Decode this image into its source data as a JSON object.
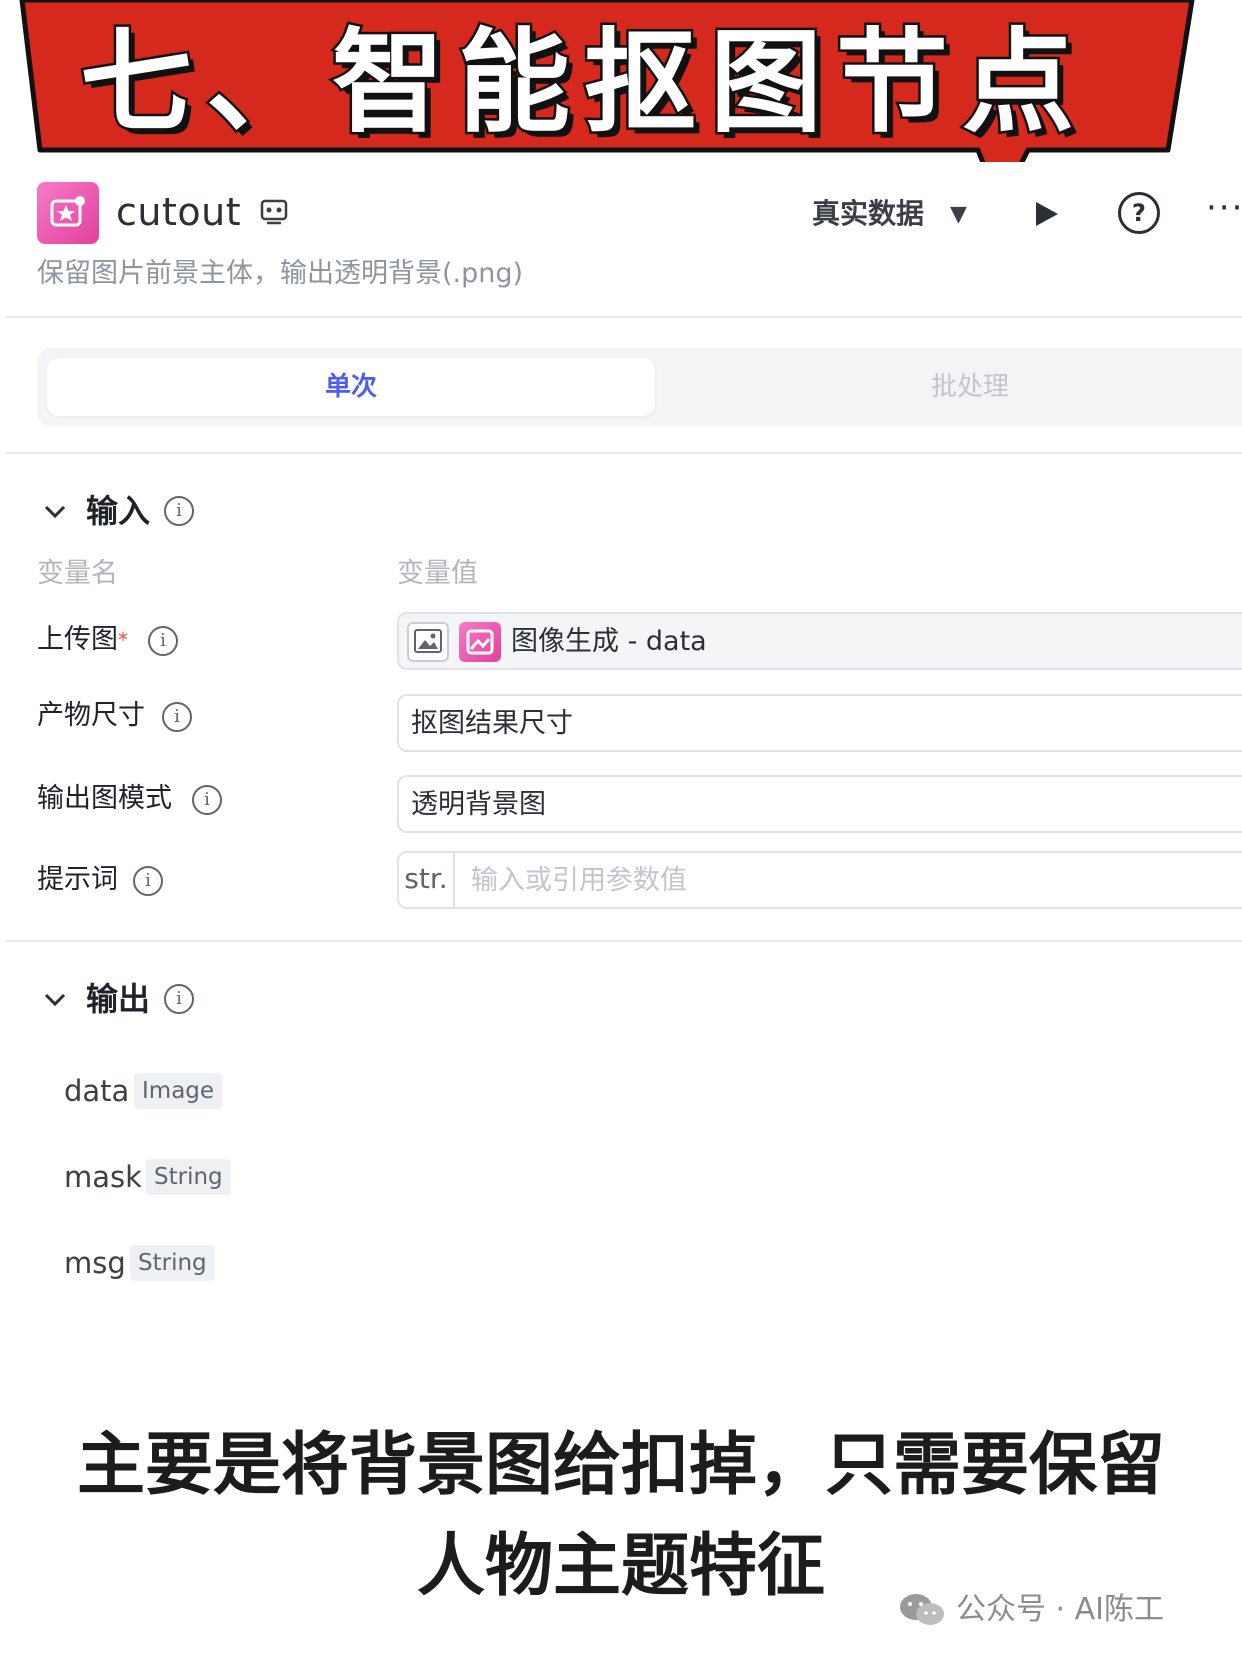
{
  "banner": {
    "title": "七、智能抠图节点",
    "bg_color": "#d4291c"
  },
  "node": {
    "name": "cutout",
    "description": "保留图片前景主体，输出透明背景(.png)",
    "data_mode": "真实数据",
    "icon": "sparkle-image-icon"
  },
  "tabs": {
    "single": "单次",
    "batch": "批处理"
  },
  "input": {
    "title": "输入",
    "col_name": "变量名",
    "col_value": "变量值",
    "params": [
      {
        "label": "上传图",
        "required_mark": "*",
        "value": "图像生成 - data"
      },
      {
        "label": "产物尺寸",
        "value": "抠图结果尺寸"
      },
      {
        "label": "输出图模式",
        "value": "透明背景图"
      },
      {
        "label": "提示词",
        "prefix": "str.",
        "placeholder": "输入或引用参数值"
      }
    ]
  },
  "output": {
    "title": "输出",
    "items": [
      {
        "name": "data",
        "type": "Image"
      },
      {
        "name": "mask",
        "type": "String"
      },
      {
        "name": "msg",
        "type": "String"
      }
    ]
  },
  "caption": {
    "line1": "主要是将背景图给扣掉，只需要保留",
    "line2": "人物主题特征"
  },
  "watermark": {
    "text": "公众号 · AI陈工",
    "icon": "wechat-icon"
  },
  "colors": {
    "accent": "#4e5cf0",
    "node_icon": "#e2419d",
    "required": "#f04b4b"
  }
}
